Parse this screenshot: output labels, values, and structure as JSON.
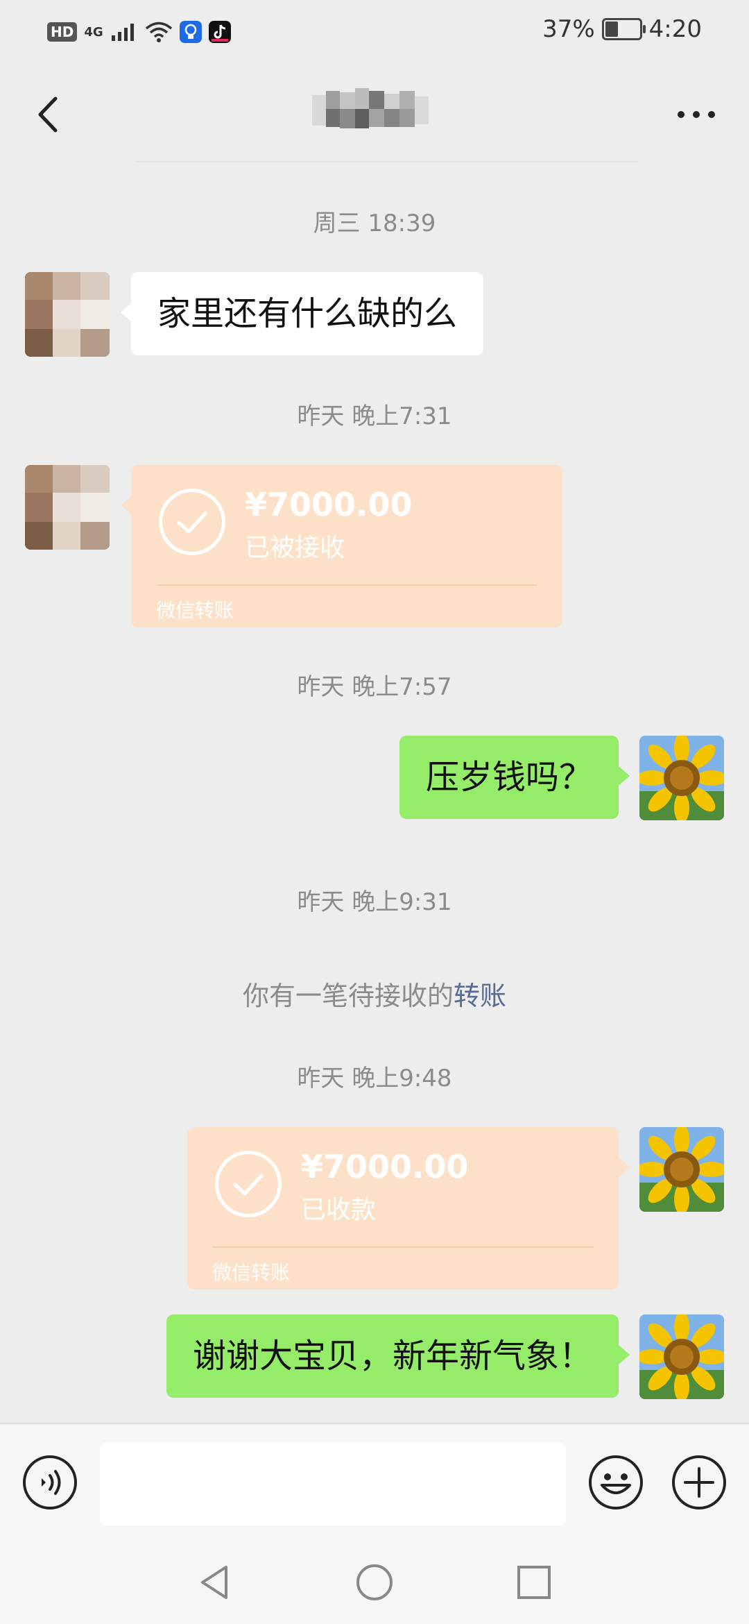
{
  "status_bar": {
    "hd": "HD",
    "network": "4G",
    "battery_text": "37%",
    "battery_level": 0.37,
    "time": "4:20"
  },
  "header": {
    "back_icon": "chevron-left-icon",
    "more_icon": "more-dots-icon"
  },
  "messages": [
    {
      "type": "time",
      "text": "周三 18:39"
    },
    {
      "type": "text",
      "side": "left",
      "text": "家里还有什么缺的么"
    },
    {
      "type": "time",
      "text": "昨天 晚上7:31"
    },
    {
      "type": "transfer",
      "side": "left",
      "amount": "¥7000.00",
      "status": "已被接收",
      "footer": "微信转账"
    },
    {
      "type": "time",
      "text": "昨天 晚上7:57"
    },
    {
      "type": "text",
      "side": "right",
      "text": "压岁钱吗？"
    },
    {
      "type": "time",
      "text": "昨天 晚上9:31"
    },
    {
      "type": "system",
      "prefix": "你有一笔待接收的",
      "link": "转账"
    },
    {
      "type": "time",
      "text": "昨天 晚上9:48"
    },
    {
      "type": "transfer",
      "side": "right",
      "amount": "¥7000.00",
      "status": "已收款",
      "footer": "微信转账"
    },
    {
      "type": "text",
      "side": "right",
      "text": "谢谢大宝贝，新年新气象！"
    }
  ],
  "input_bar": {
    "voice_icon": "voice-icon",
    "emoji_icon": "emoji-icon",
    "plus_icon": "plus-icon",
    "input_value": ""
  },
  "colors": {
    "background": "#ededed",
    "green_bubble": "#95ec69",
    "transfer_card": "#fce1c8",
    "link": "#576b95"
  }
}
